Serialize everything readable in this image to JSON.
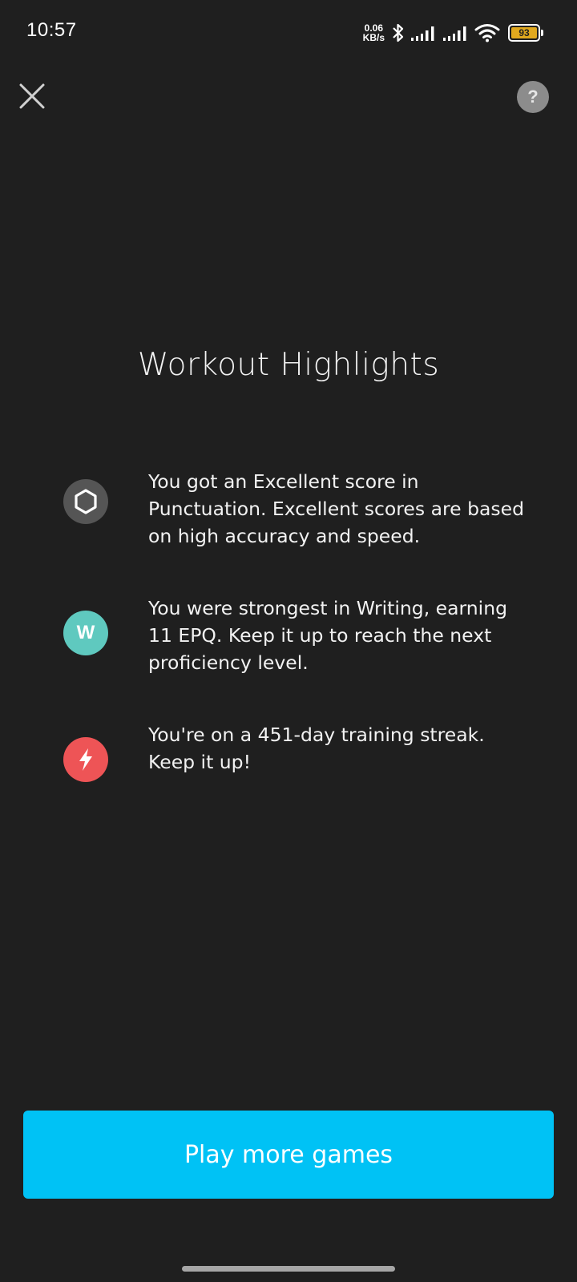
{
  "status_bar": {
    "time": "10:57",
    "net_speed_value": "0.06",
    "net_speed_unit": "KB/s",
    "battery_level": "93",
    "icons": [
      "bluetooth-icon",
      "signal-icon",
      "signal-icon",
      "wifi-icon",
      "battery-icon"
    ]
  },
  "header": {
    "close_icon": "close-icon",
    "help_label": "?"
  },
  "page": {
    "title": "Workout Highlights"
  },
  "highlights": [
    {
      "icon": "hexagon-icon",
      "icon_color": "#555555",
      "text": "You got an Excellent score in Punctuation. Excellent scores are based on high accuracy and speed."
    },
    {
      "icon": "writing-letter-icon",
      "icon_label": "W",
      "icon_color": "#5fc9bf",
      "text": "You were strongest in Writing, earning 11 EPQ. Keep it up to reach the next proficiency level."
    },
    {
      "icon": "lightning-bolt-icon",
      "icon_color": "#ee5456",
      "text": "You're on a 451-day training streak. Keep it up!"
    }
  ],
  "cta": {
    "label": "Play more games",
    "color": "#00c2f5"
  },
  "colors": {
    "background": "#1f1f1f",
    "text": "#f2f2f2"
  }
}
